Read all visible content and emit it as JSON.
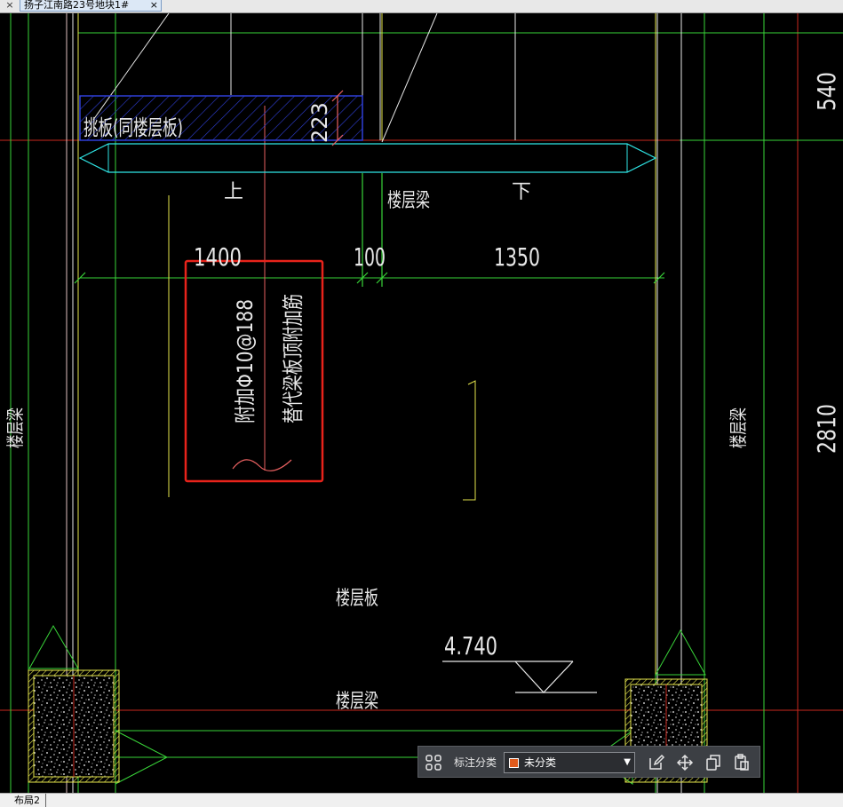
{
  "tabs": {
    "close_left": "×",
    "document_title": "扬子江南路23号地块1#",
    "document_close": "×"
  },
  "drawing": {
    "labels": {
      "cantilever_slab": "挑板(同楼层板)",
      "dim_223": "223",
      "up": "上",
      "down": "下",
      "floor_beam_top": "楼层梁",
      "dim_1400": "1400",
      "dim_100": "100",
      "dim_1350": "1350",
      "note_line1": "附加Φ10@188",
      "note_line2": "替代梁板顶附加筋",
      "floor_beam_left": "楼层梁",
      "floor_beam_right": "楼层梁",
      "dim_540": "540",
      "dim_2810": "2810",
      "floor_slab": "楼层板",
      "elevation": "4.740",
      "floor_beam_bottom": "楼层梁"
    },
    "colors": {
      "green": "#39d439",
      "yellow": "#e6e64d",
      "white": "#e8e8e8",
      "cyan": "#2fe6e6",
      "blue": "#2f3fd8",
      "red": "#c8281e",
      "highlight": "#e8231b"
    }
  },
  "toolbar": {
    "grid_icon": "grid-icon",
    "category_label": "标注分类",
    "category_value": "未分类",
    "category_color": "#e05a1c",
    "icons": [
      "edit-icon",
      "move-icon",
      "copy-icon",
      "paste-icon"
    ]
  },
  "status": {
    "layout_tab": "布局2"
  }
}
